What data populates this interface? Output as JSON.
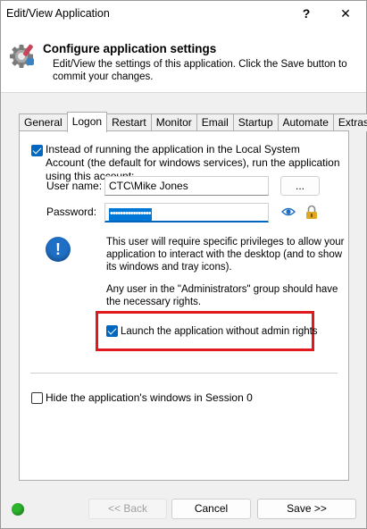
{
  "window": {
    "title": "Edit/View Application",
    "help_label": "?",
    "close_label": "✕"
  },
  "header": {
    "icon": "gear-icon",
    "title": "Configure application settings",
    "description": "Edit/View the settings of this application. Click the Save button to commit your changes."
  },
  "tabs": [
    {
      "label": "General"
    },
    {
      "label": "Logon"
    },
    {
      "label": "Restart"
    },
    {
      "label": "Monitor"
    },
    {
      "label": "Email"
    },
    {
      "label": "Startup"
    },
    {
      "label": "Automate"
    },
    {
      "label": "Extras"
    }
  ],
  "active_tab": "Logon",
  "logon": {
    "run_as_account_checked": true,
    "run_as_account_label": "Instead of running the application in the Local System Account (the default for windows services), run the application using this account:",
    "username_label": "User name:",
    "username_value": "CTC\\Mike Jones",
    "browse_label": "...",
    "password_label": "Password:",
    "password_value": "••••••••••••••••",
    "show_password_icon": "eye-icon",
    "password_lock_icon": "lock-icon",
    "info_icon": "info-icon",
    "info_text_1": "This user will require specific privileges to allow your application to interact with the desktop (and to show its windows and tray icons).",
    "info_text_2": "Any user in the \"Administrators\" group should have the necessary rights.",
    "launch_without_admin_checked": true,
    "launch_without_admin_label": "Launch the application without admin rights",
    "hide_windows_checked": false,
    "hide_windows_label": "Hide the application's windows in Session 0"
  },
  "footer": {
    "status_color": "#2db52d",
    "back_label": "<< Back",
    "cancel_label": "Cancel",
    "save_label": "Save >>"
  },
  "colors": {
    "accent": "#0067c0",
    "highlight_border": "#e0191e"
  }
}
